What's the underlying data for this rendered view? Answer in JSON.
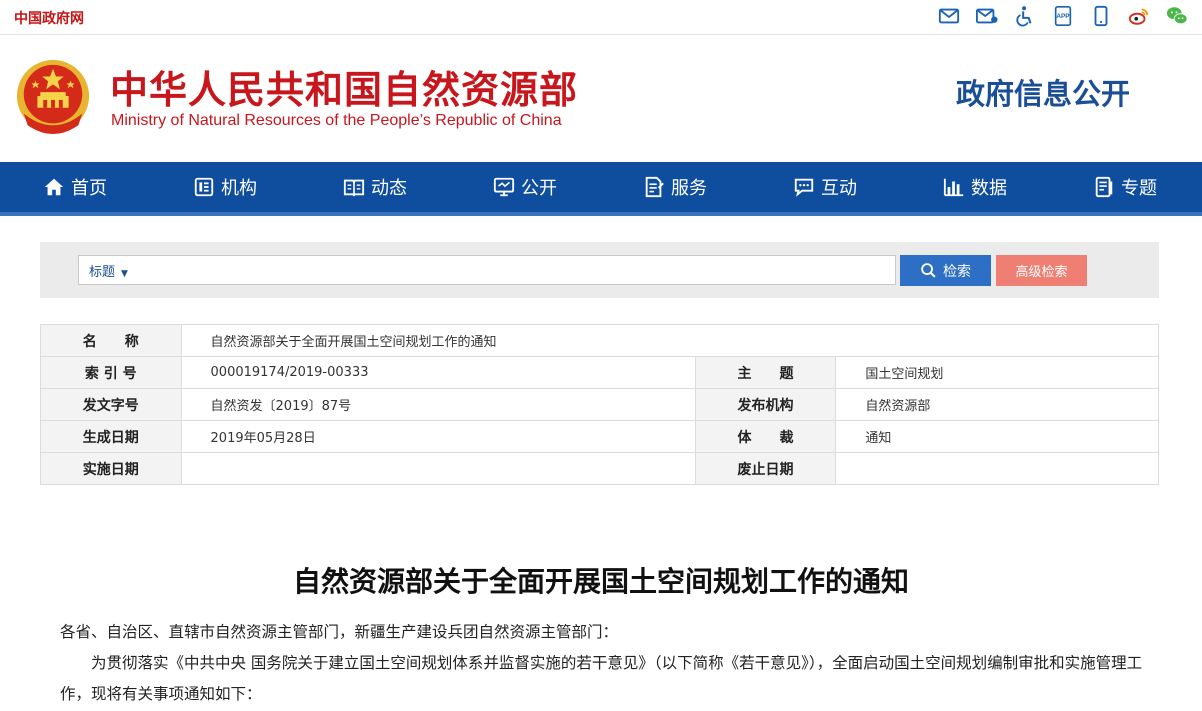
{
  "topbar": {
    "gov_link": "中国政府网",
    "icons": [
      "mail-icon",
      "mailbox-icon",
      "accessibility-icon",
      "app-icon",
      "mobile-icon",
      "weibo-icon",
      "wechat-icon"
    ],
    "app_text": "APP"
  },
  "header": {
    "ministry_cn": "中华人民共和国自然资源部",
    "ministry_en": "Ministry of Natural Resources of the People’s Republic of China",
    "gov_info": "政府信息公开"
  },
  "nav": {
    "items": [
      {
        "label": "首页",
        "icon": "home-icon"
      },
      {
        "label": "机构",
        "icon": "org-icon"
      },
      {
        "label": "动态",
        "icon": "book-icon"
      },
      {
        "label": "公开",
        "icon": "monitor-icon"
      },
      {
        "label": "服务",
        "icon": "edit-doc-icon"
      },
      {
        "label": "互动",
        "icon": "chat-icon"
      },
      {
        "label": "数据",
        "icon": "bar-chart-icon"
      },
      {
        "label": "专题",
        "icon": "document-icon"
      }
    ]
  },
  "search": {
    "type_label": "标题",
    "query": "",
    "search_label": "检索",
    "advanced_label": "高级检索"
  },
  "meta": {
    "name_key": "名　　称",
    "name_value": "自然资源部关于全面开展国土空间规划工作的通知",
    "index_key": "索 引 号",
    "index_value": "000019174/2019-00333",
    "subject_key": "主　　题",
    "subject_value": "国土空间规划",
    "docno_key": "发文字号",
    "docno_value": "自然资发〔2019〕87号",
    "publisher_key": "发布机构",
    "publisher_value": "自然资源部",
    "created_key": "生成日期",
    "created_value": "2019年05月28日",
    "genre_key": "体　　裁",
    "genre_value": "通知",
    "effective_key": "实施日期",
    "effective_value": "",
    "expiry_key": "废止日期",
    "expiry_value": ""
  },
  "article": {
    "title": "自然资源部关于全面开展国土空间规划工作的通知",
    "p1": "各省、自治区、直辖市自然资源主管部门，新疆生产建设兵团自然资源主管部门：",
    "p2": "为贯彻落实《中共中央 国务院关于建立国土空间规划体系并监督实施的若干意见》（以下简称《若干意见》），全面启动国土空间规划编制审批和实施管理工作，现将有关事项通知如下："
  },
  "colors": {
    "brand_red": "#c8161d",
    "nav_blue": "#0f4e9f",
    "title_blue": "#1b4f95",
    "search_blue": "#2c6fc4",
    "advanced_salmon": "#f07f73"
  }
}
